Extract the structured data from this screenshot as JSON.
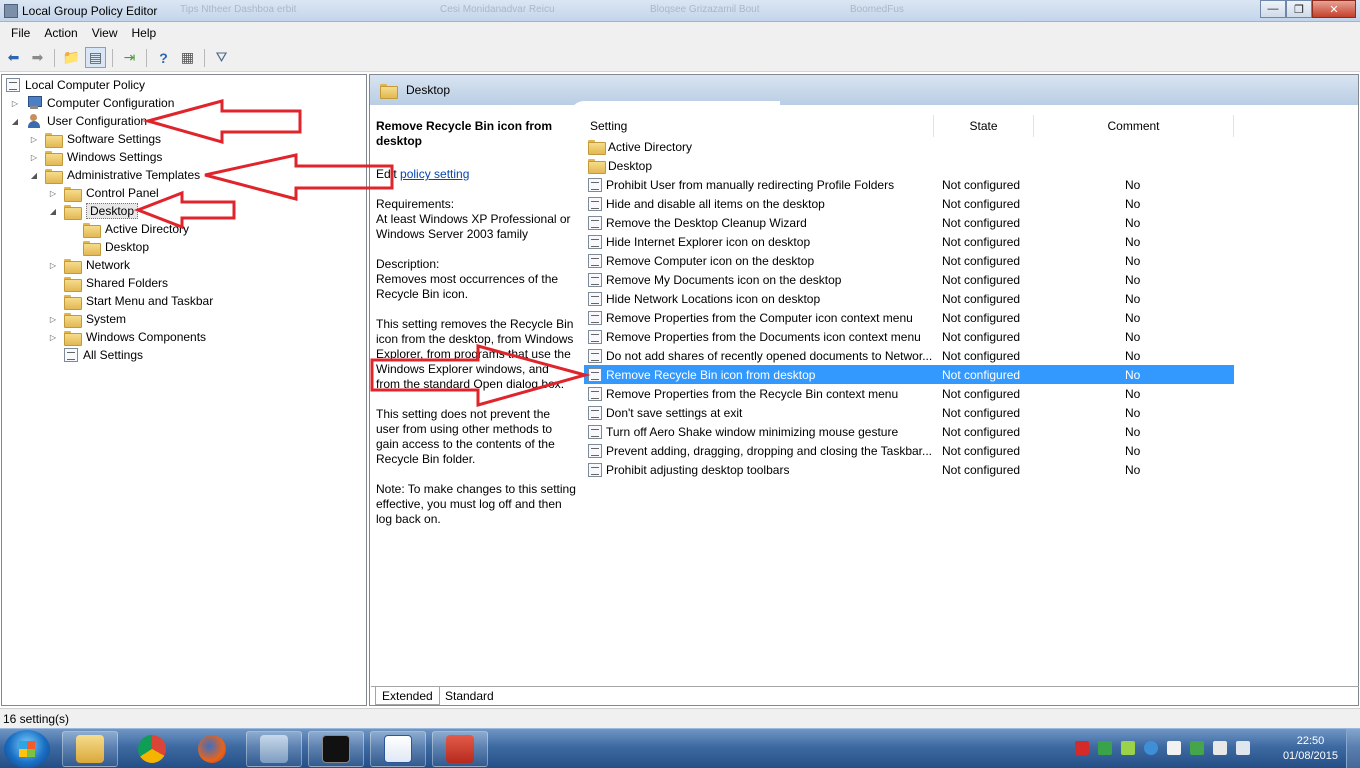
{
  "window": {
    "title": "Local Group Policy Editor",
    "ghost_tabs": [
      "Tips Ntheer Dashboa erbit",
      "Cesi Monidanadvar Reicu",
      "Bloqsee Grizazamil Bout",
      "BoomedFus"
    ]
  },
  "menubar": [
    "File",
    "Action",
    "View",
    "Help"
  ],
  "toolbar": [
    "back-icon",
    "forward-icon",
    "up-folder-icon",
    "show-hide-tree-icon",
    "export-list-icon",
    "help-icon",
    "properties-icon",
    "filter-icon"
  ],
  "tree": {
    "root": "Local Computer Policy",
    "computer_configuration": "Computer Configuration",
    "user_configuration": "User Configuration",
    "software_settings": "Software Settings",
    "windows_settings": "Windows Settings",
    "administrative_templates": "Administrative Templates",
    "control_panel": "Control Panel",
    "desktop": "Desktop",
    "active_directory": "Active Directory",
    "desktop_sub": "Desktop",
    "network": "Network",
    "shared_folders": "Shared Folders",
    "start_menu": "Start Menu and Taskbar",
    "system": "System",
    "windows_components": "Windows Components",
    "all_settings": "All Settings"
  },
  "right_pane": {
    "header": "Desktop",
    "description": {
      "title": "Remove Recycle Bin icon from desktop",
      "edit_prefix": "Edit",
      "edit_link": "policy setting",
      "requirements_label": "Requirements:",
      "requirements": "At least Windows XP Professional or Windows Server 2003 family",
      "description_label": "Description:",
      "description": "Removes most occurrences of the Recycle Bin icon.",
      "para1": "This setting removes the Recycle Bin icon from the desktop, from Windows Explorer, from programs that use the Windows Explorer windows, and from the standard Open dialog box.",
      "para2": "This setting does not prevent the user from using other methods to gain access to the contents of the Recycle Bin folder.",
      "note": "Note: To make changes to this setting effective, you must log off and then log back on."
    },
    "columns": {
      "setting": "Setting",
      "state": "State",
      "comment": "Comment"
    },
    "folders": [
      "Active Directory",
      "Desktop"
    ],
    "settings": [
      {
        "name": "Prohibit User from manually redirecting Profile Folders",
        "state": "Not configured",
        "comment": "No"
      },
      {
        "name": "Hide and disable all items on the desktop",
        "state": "Not configured",
        "comment": "No"
      },
      {
        "name": "Remove the Desktop Cleanup Wizard",
        "state": "Not configured",
        "comment": "No"
      },
      {
        "name": "Hide Internet Explorer icon on desktop",
        "state": "Not configured",
        "comment": "No"
      },
      {
        "name": "Remove Computer icon on the desktop",
        "state": "Not configured",
        "comment": "No"
      },
      {
        "name": "Remove My Documents icon on the desktop",
        "state": "Not configured",
        "comment": "No"
      },
      {
        "name": "Hide Network Locations icon on desktop",
        "state": "Not configured",
        "comment": "No"
      },
      {
        "name": "Remove Properties from the Computer icon context menu",
        "state": "Not configured",
        "comment": "No"
      },
      {
        "name": "Remove Properties from the Documents icon context menu",
        "state": "Not configured",
        "comment": "No"
      },
      {
        "name": "Do not add shares of recently opened documents to Networ...",
        "state": "Not configured",
        "comment": "No"
      },
      {
        "name": "Remove Recycle Bin icon from desktop",
        "state": "Not configured",
        "comment": "No"
      },
      {
        "name": "Remove Properties from the Recycle Bin context menu",
        "state": "Not configured",
        "comment": "No"
      },
      {
        "name": "Don't save settings at exit",
        "state": "Not configured",
        "comment": "No"
      },
      {
        "name": "Turn off Aero Shake window minimizing mouse gesture",
        "state": "Not configured",
        "comment": "No"
      },
      {
        "name": "Prevent adding, dragging, dropping and closing the Taskbar...",
        "state": "Not configured",
        "comment": "No"
      },
      {
        "name": "Prohibit adjusting desktop toolbars",
        "state": "Not configured",
        "comment": "No"
      }
    ],
    "selected_index": 10
  },
  "tabs": [
    "Extended",
    "Standard"
  ],
  "status": "16 setting(s)",
  "taskbar": {
    "apps": [
      "windows-explorer-icon",
      "chrome-icon",
      "firefox-icon",
      "control-panel-icon",
      "command-prompt-icon",
      "word-icon",
      "toolbox-icon"
    ],
    "time": "22:50",
    "date": "01/08/2015"
  },
  "colors": {
    "selection": "#3399ff",
    "annotation_arrow": "#e0242b",
    "header_band": "#c9d9ec"
  }
}
